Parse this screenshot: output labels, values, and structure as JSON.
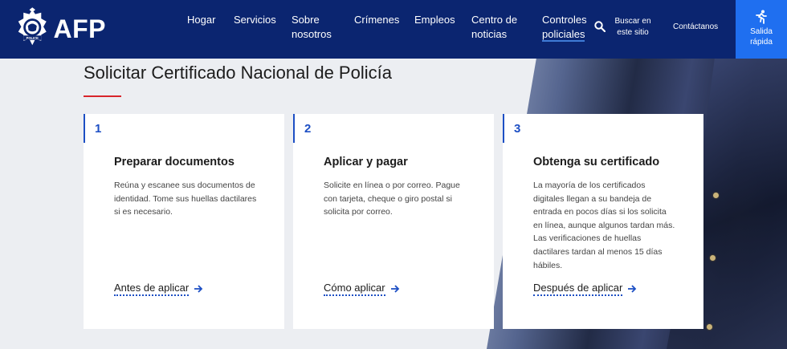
{
  "brand": {
    "logo_text": "AFP",
    "badge_text": "POLICE"
  },
  "nav": [
    {
      "label": "Hogar"
    },
    {
      "label": "Servicios"
    },
    {
      "label_line1": "Sobre",
      "label_line2": "nosotros"
    },
    {
      "label": "Crímenes"
    },
    {
      "label": "Empleos"
    },
    {
      "label_line1": "Centro de",
      "label_line2": "noticias"
    },
    {
      "label_line1": "Controles",
      "label_line2": "policiales"
    }
  ],
  "search": {
    "label_line1": "Buscar en",
    "label_line2": "este sitio",
    "icon": "search-icon"
  },
  "contact": {
    "label": "Contáctanos"
  },
  "quick_exit": {
    "label_line1": "Salida",
    "label_line2": "rápida",
    "icon": "running-person-icon",
    "color": "#1f6ff0"
  },
  "page": {
    "title": "Solicitar Certificado Nacional de Policía",
    "accent": "#d8252b"
  },
  "steps": [
    {
      "number": "1",
      "heading": "Preparar documentos",
      "body": "Reúna y escanee sus documentos de identidad. Tome sus huellas dactilares si es necesario.",
      "link": "Antes de aplicar"
    },
    {
      "number": "2",
      "heading": "Aplicar y pagar",
      "body": "Solicite en línea o por correo. Pague con tarjeta, cheque o giro postal si solicita por correo.",
      "link": "Cómo aplicar"
    },
    {
      "number": "3",
      "heading": "Obtenga su certificado",
      "body": "La mayoría de los certificados digitales llegan a su bandeja de entrada en pocos días si los solicita en línea, aunque algunos tardan más. Las verificaciones de huellas dactilares tardan al menos 15 días hábiles.",
      "link": "Después de aplicar"
    }
  ],
  "colors": {
    "header_bg": "#0b2570",
    "step_accent": "#1d4fc4"
  }
}
